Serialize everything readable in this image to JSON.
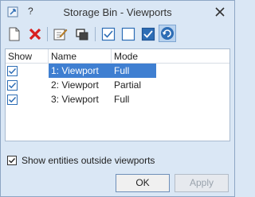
{
  "window": {
    "title": "Storage Bin - Viewports",
    "help": "?"
  },
  "toolbar": {
    "items": [
      {
        "icon": "new-icon"
      },
      {
        "icon": "delete-icon"
      },
      {
        "icon": "edit-icon"
      },
      {
        "icon": "copy-icon"
      },
      {
        "icon": "check-all-icon"
      },
      {
        "icon": "uncheck-all-icon"
      },
      {
        "icon": "toggle-check-icon"
      },
      {
        "icon": "refresh-icon",
        "pressed": true
      }
    ]
  },
  "list": {
    "columns": [
      "Show",
      "Name",
      "Mode"
    ],
    "rows": [
      {
        "show": true,
        "name": "1: Viewport",
        "mode": "Full",
        "selected": true
      },
      {
        "show": true,
        "name": "2: Viewport",
        "mode": "Partial",
        "selected": false
      },
      {
        "show": true,
        "name": "3: Viewport",
        "mode": "Full",
        "selected": false
      }
    ]
  },
  "option": {
    "label": "Show entities outside viewports",
    "checked": true
  },
  "buttons": {
    "ok": "OK",
    "apply": "Apply"
  },
  "colors": {
    "selection": "#3f7fd1",
    "accent": "#2d6db5",
    "delete": "#d81f1f"
  }
}
